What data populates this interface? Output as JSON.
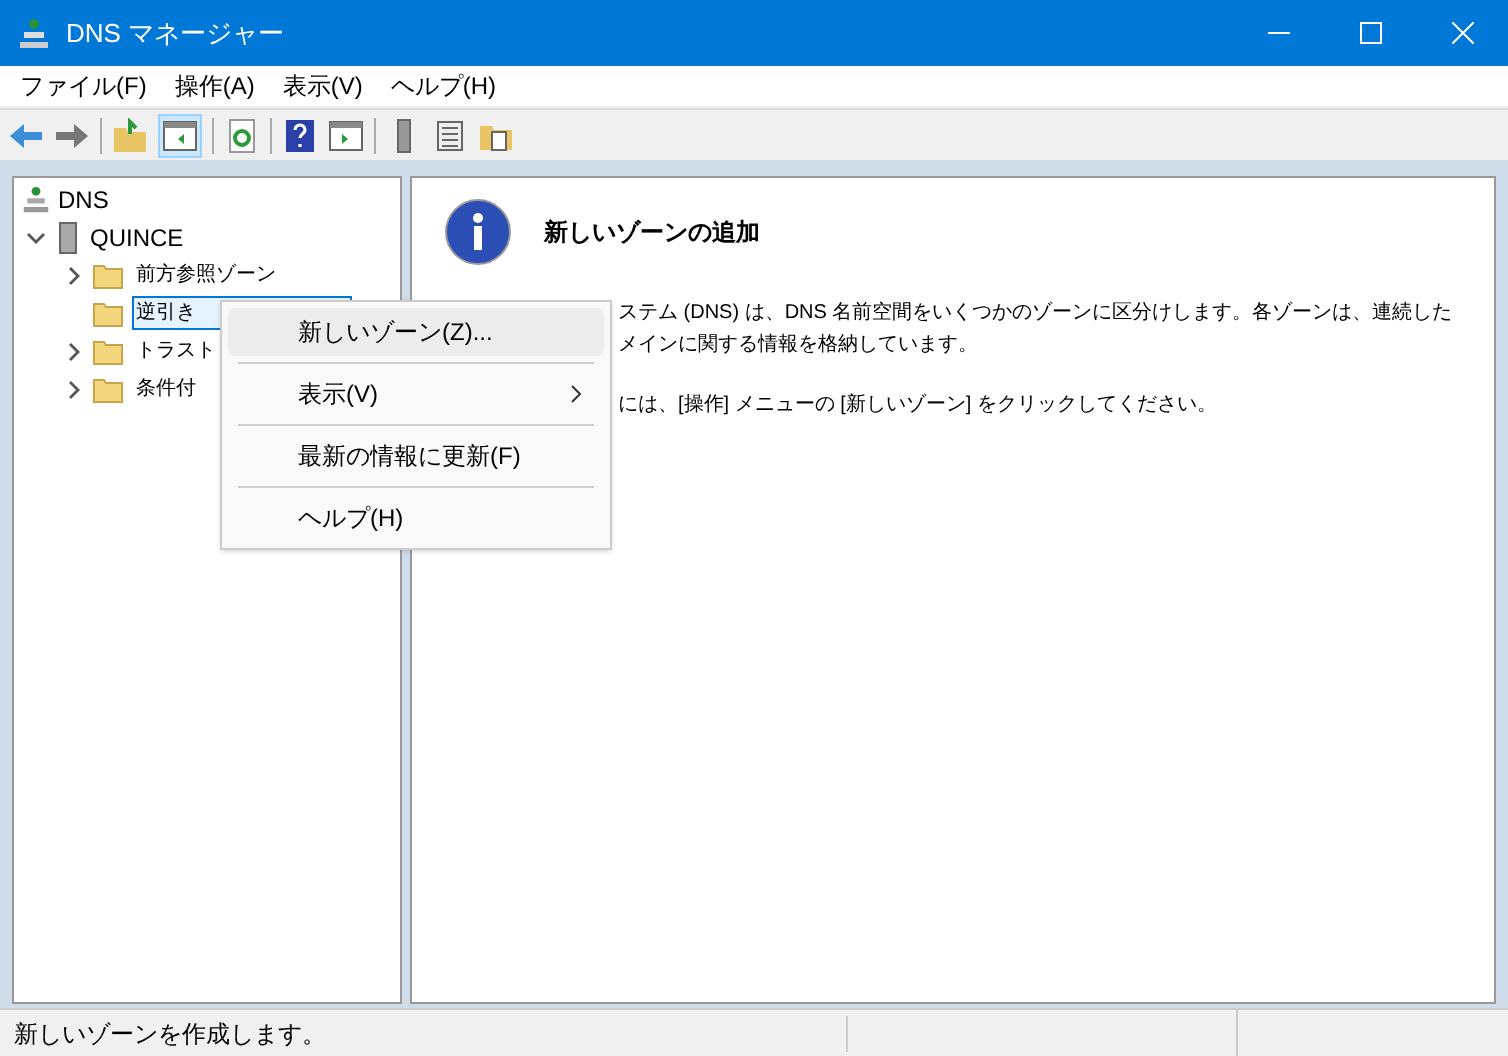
{
  "window": {
    "title": "DNS マネージャー"
  },
  "menu": [
    "ファイル(F)",
    "操作(A)",
    "表示(V)",
    "ヘルプ(H)"
  ],
  "tree": {
    "label": "DNS",
    "children": [
      {
        "label": "QUINCE",
        "expanded": true,
        "children": [
          {
            "label": "前方参照ゾーン",
            "selected": false,
            "expandable": true
          },
          {
            "label": "逆引き",
            "selected": true,
            "expandable": false
          },
          {
            "label": "トラスト",
            "selected": false,
            "expandable": true
          },
          {
            "label": "条件付",
            "selected": false,
            "expandable": true
          }
        ]
      }
    ]
  },
  "content": {
    "heading": "新しいゾーンの追加",
    "lines": [
      "ステム (DNS) は、DNS 名前空間をいくつかのゾーンに区分けします。各ゾーンは、連続した",
      "メインに関する情報を格納しています。"
    ],
    "hint": "には、[操作] メニューの [新しいゾーン] をクリックしてください。"
  },
  "context_menu": [
    {
      "label": "新しいゾーン(Z)...",
      "selected": true,
      "submenu": false
    },
    {
      "label": "表示(V)",
      "selected": false,
      "submenu": true
    },
    {
      "label": "最新の情報に更新(F)",
      "selected": false,
      "submenu": false
    },
    {
      "label": "ヘルプ(H)",
      "selected": false,
      "submenu": false
    }
  ],
  "status_bar": "新しいゾーンを作成します。"
}
